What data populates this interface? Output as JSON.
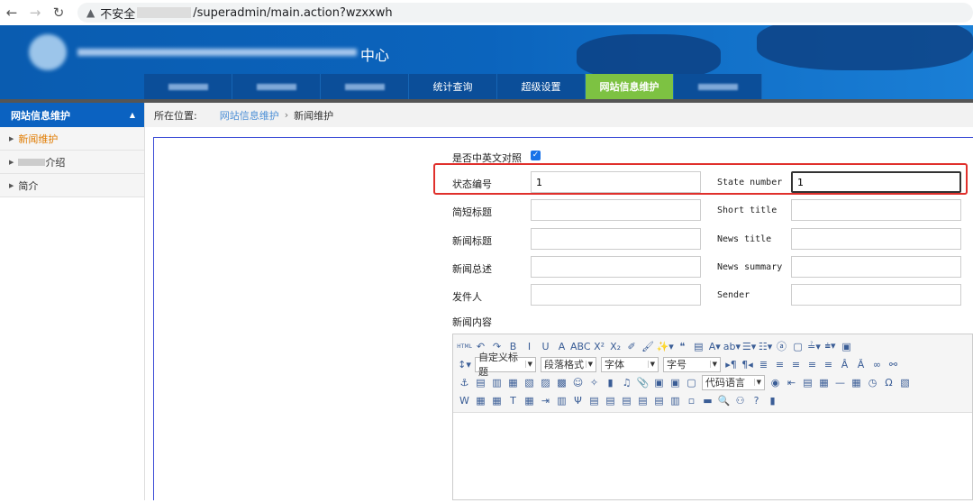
{
  "browser": {
    "security": "不安全",
    "url": "/superadmin/main.action?wzxxwh"
  },
  "header": {
    "title": "中心",
    "tabs": [
      {
        "label": ""
      },
      {
        "label": ""
      },
      {
        "label": ""
      },
      {
        "label": "统计查询"
      },
      {
        "label": "超级设置"
      },
      {
        "label": "网站信息维护",
        "active": true
      },
      {
        "label": ""
      }
    ]
  },
  "sidebar": {
    "title": "网站信息维护",
    "items": [
      {
        "label": "新闻维护",
        "active": true
      },
      {
        "label": "介绍"
      },
      {
        "label": "简介"
      }
    ]
  },
  "breadcrumb": {
    "prefix": "所在位置:",
    "link": "网站信息维护",
    "current": "新闻维护"
  },
  "form": {
    "bilingual_label": "是否中英文对照",
    "bilingual_checked": true,
    "state_cn": "状态编号",
    "state_cn_value": "1",
    "state_en": "State number",
    "state_en_value": "1",
    "short_cn": "简短标题",
    "short_en": "Short title",
    "title_cn": "新闻标题",
    "title_en": "News title",
    "summary_cn": "新闻总述",
    "summary_en": "News summary",
    "sender_cn": "发件人",
    "sender_en": "Sender",
    "content_label": "新闻内容"
  },
  "editor": {
    "row1": [
      "HTML",
      "↶",
      "↷",
      "B",
      "I",
      "U",
      "A",
      "ABC",
      "X²",
      "X₂",
      "✐",
      "🖌",
      "✨▾",
      "❝",
      "▤",
      "A▾",
      "ab▾",
      "☰▾",
      "☷▾",
      "ⓐ",
      "▢",
      "≟▾",
      "⩧▾",
      "▣"
    ],
    "row2_pre": [
      "↕▾"
    ],
    "dropdowns": [
      "自定义标题",
      "段落格式",
      "字体",
      "字号"
    ],
    "row2_post": [
      "▸¶",
      "¶◂",
      "≣",
      "≡",
      "≡",
      "≡",
      "≡",
      "Â",
      "Ǎ",
      "∞",
      "⚯"
    ],
    "row3": [
      "⚓",
      "▤",
      "▥",
      "▦",
      "▧",
      "▨",
      "▩",
      "☺",
      "✧",
      "▮",
      "♫",
      "📎",
      "▣",
      "▣",
      "▢"
    ],
    "code_dropdown": "代码语言",
    "row3_post": [
      "◉",
      "⇤",
      "▤",
      "▦",
      "—",
      "▦",
      "◷",
      "Ω",
      "▧"
    ],
    "row4": [
      "W",
      "▦",
      "▦",
      "T",
      "▦",
      "⇥",
      "▥",
      "Ψ",
      "▤",
      "▤",
      "▤",
      "▤",
      "▤",
      "▥",
      "▫",
      "▬",
      "🔍",
      "⚇",
      "?",
      "▮"
    ]
  },
  "colors": {
    "header": "#0b64bd",
    "active_tab": "#7dc242",
    "highlight": "#e0302c",
    "link": "#4a8ed6"
  }
}
